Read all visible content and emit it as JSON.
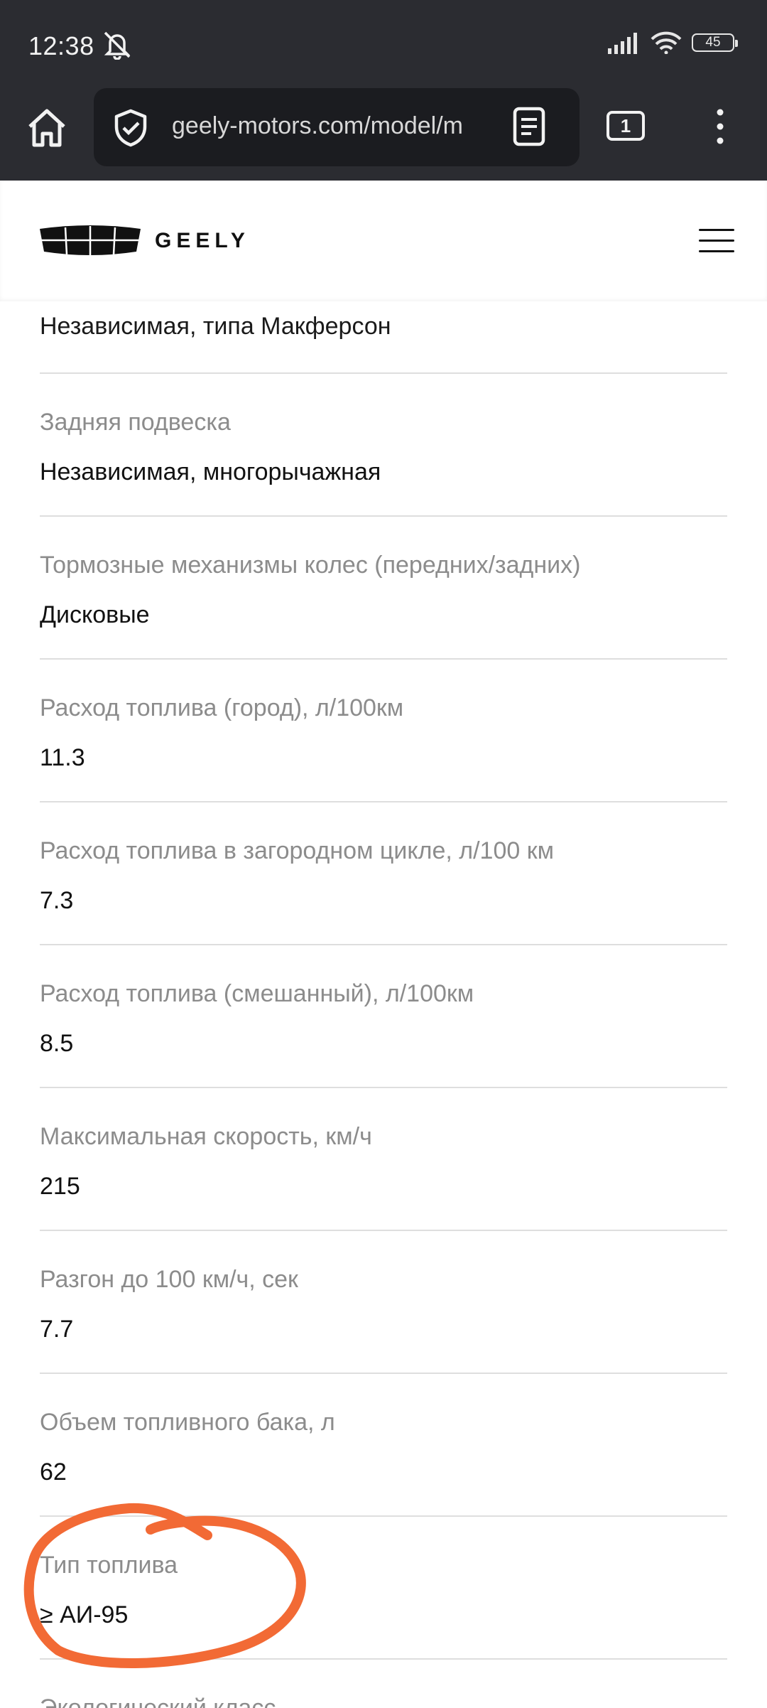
{
  "status_bar": {
    "time": "12:38",
    "battery": "45"
  },
  "browser": {
    "url": "geely-motors.com/model/m",
    "tab_count": "1"
  },
  "site": {
    "logo_text": "GEELY"
  },
  "specs": {
    "first_value": "Независимая, типа Макферсон",
    "rows": [
      {
        "label": "Задняя подвеска",
        "value": "Независимая, многорычажная"
      },
      {
        "label": "Тормозные механизмы колес (передних/задних)",
        "value": "Дисковые"
      },
      {
        "label": "Расход топлива (город), л/100км",
        "value": "11.3"
      },
      {
        "label": "Расход топлива в загородном цикле, л/100 км",
        "value": "7.3"
      },
      {
        "label": "Расход топлива (смешанный), л/100км",
        "value": "8.5"
      },
      {
        "label": "Максимальная скорость, км/ч",
        "value": "215"
      },
      {
        "label": "Разгон до 100 км/ч, сек",
        "value": "7.7"
      },
      {
        "label": "Объем топливного бака, л",
        "value": "62"
      },
      {
        "label": "Тип топлива",
        "value": "≥ АИ-95"
      }
    ],
    "partial_label": "Экологический класс"
  },
  "colors": {
    "chrome": "#2b2c31",
    "urlbar": "#1b1c20",
    "highlight": "#f26a35"
  }
}
